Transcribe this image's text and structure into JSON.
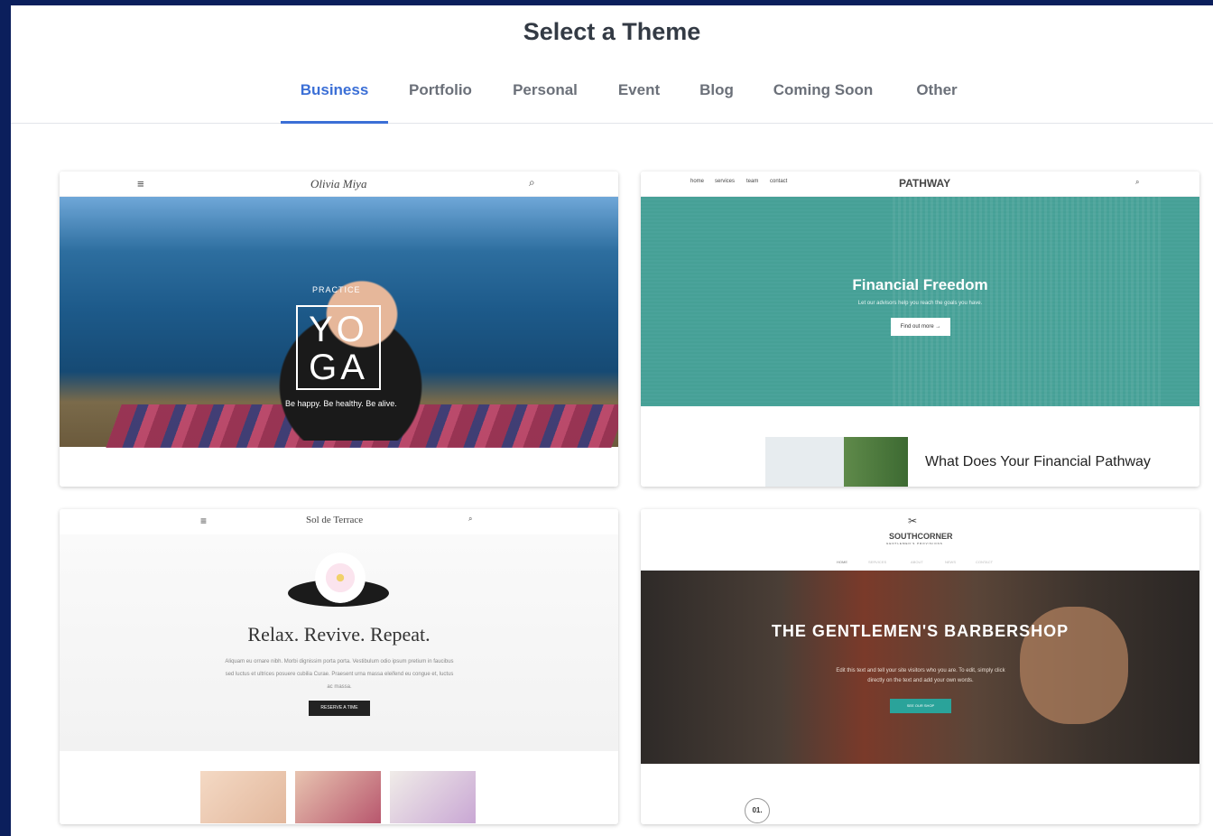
{
  "page": {
    "title": "Select a Theme"
  },
  "tabs": [
    {
      "label": "Business",
      "active": true
    },
    {
      "label": "Portfolio"
    },
    {
      "label": "Personal"
    },
    {
      "label": "Event"
    },
    {
      "label": "Blog"
    },
    {
      "label": "Coming Soon"
    },
    {
      "label": "Other"
    }
  ],
  "colors": {
    "background": "#0b1f5c",
    "accent": "#3b6fd6",
    "tab_text": "#6b7079",
    "title_text": "#333a44"
  },
  "themes": [
    {
      "brand": "Olivia Miya",
      "hero_kicker": "PRACTICE",
      "hero_text": "YO GA",
      "hero_sub": "Be happy. Be healthy. Be alive.",
      "icons": [
        "menu-icon",
        "search-icon"
      ]
    },
    {
      "brand": "PATHWAY",
      "nav": [
        "home",
        "services",
        "team",
        "contact"
      ],
      "hero_title": "Financial Freedom",
      "hero_sub": "Let our advisors help you reach the goals you have.",
      "hero_button": "Find out more →",
      "section_heading": "What Does Your Financial Pathway"
    },
    {
      "brand": "Sol de Terrace",
      "hero_title": "Relax. Revive. Repeat.",
      "hero_body": "Aliquam eu ornare nibh. Morbi dignissim porta porta. Vestibulum odio ipsum pretium in faucibus sed luctus et ultrices posuere cubilia Curae. Praesent urna massa eleifend eu congue et, luctus ac massa.",
      "hero_button": "RESERVE A TIME"
    },
    {
      "brand": "SOUTHCORNER",
      "tagline": "GENTLEMEN'S PROVISIONS",
      "nav": [
        "HOME",
        "SERVICES",
        "ABOUT",
        "NEWS",
        "CONTACT"
      ],
      "hero_title": "THE GENTLEMEN'S BARBERSHOP",
      "hero_body": "Edit this text and tell your site visitors who you are. To edit, simply click directly on the text and add your own words.",
      "hero_button": "SEE OUR SHOP",
      "badge": "01."
    }
  ]
}
